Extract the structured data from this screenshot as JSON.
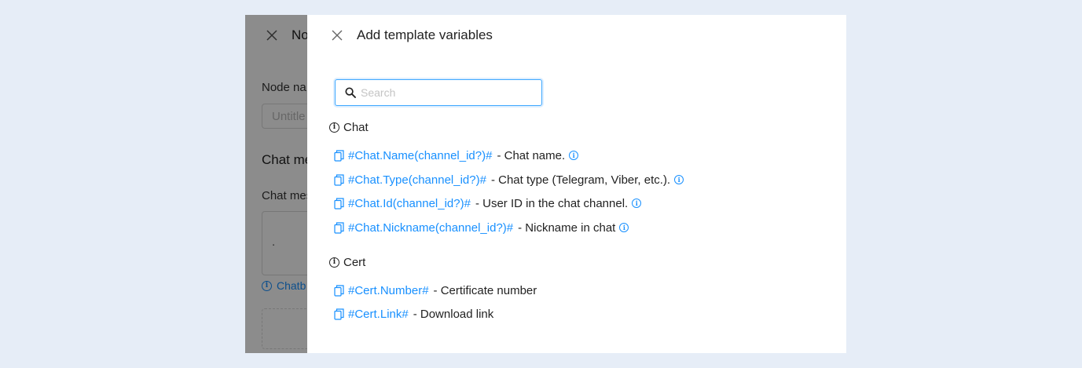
{
  "background_panel": {
    "title_partial": "No",
    "node_name_label_partial": "Node na",
    "node_name_placeholder_partial": "Untitle",
    "section_title_partial": "Chat me",
    "message_label_partial": "Chat mes",
    "message_value": ".",
    "hint_partial": "Chatb"
  },
  "modal": {
    "title": "Add template variables",
    "search": {
      "placeholder": "Search",
      "value": ""
    },
    "groups": [
      {
        "title": "Chat",
        "items": [
          {
            "variable": "#Chat.Name(channel_id?)#",
            "description": "- Chat name.",
            "has_info": true
          },
          {
            "variable": "#Chat.Type(channel_id?)#",
            "description": "- Chat type (Telegram, Viber, etc.).",
            "has_info": true
          },
          {
            "variable": "#Chat.Id(channel_id?)#",
            "description": "- User ID in the chat channel.",
            "has_info": true
          },
          {
            "variable": "#Chat.Nickname(channel_id?)#",
            "description": "- Nickname in chat",
            "has_info": true
          }
        ]
      },
      {
        "title": "Cert",
        "items": [
          {
            "variable": "#Cert.Number#",
            "description": "- Certificate number",
            "has_info": false
          },
          {
            "variable": "#Cert.Link#",
            "description": "- Download link",
            "has_info": false
          }
        ]
      }
    ]
  },
  "icons": {
    "close": "close-icon",
    "search": "search-icon",
    "copy": "copy-icon",
    "info": "info-icon"
  },
  "colors": {
    "accent": "#1890ff",
    "page_background": "#e6edf7",
    "overlay": "rgba(0,0,0,0.45)"
  }
}
